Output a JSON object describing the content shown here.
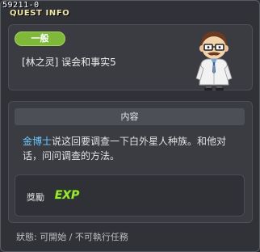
{
  "quest": {
    "id_label": "59211-0",
    "window_title": "QUEST INFO",
    "category": "一般",
    "name": "[林之灵] 误会和事实5"
  },
  "content": {
    "header": "内容",
    "npc_name": "金博士",
    "description_rest": "说这回要调查一下白外星人种族。和他对话，问问调查的方法。"
  },
  "reward": {
    "label": "獎勵",
    "exp_label": "EXP"
  },
  "status": {
    "text": "狀態: 可開始 / 不可執行任務"
  },
  "colors": {
    "category_badge": "#7fb93a",
    "npc_link": "#6ec8ff",
    "title": "#f0e7a8",
    "exp": "#9de53b"
  }
}
